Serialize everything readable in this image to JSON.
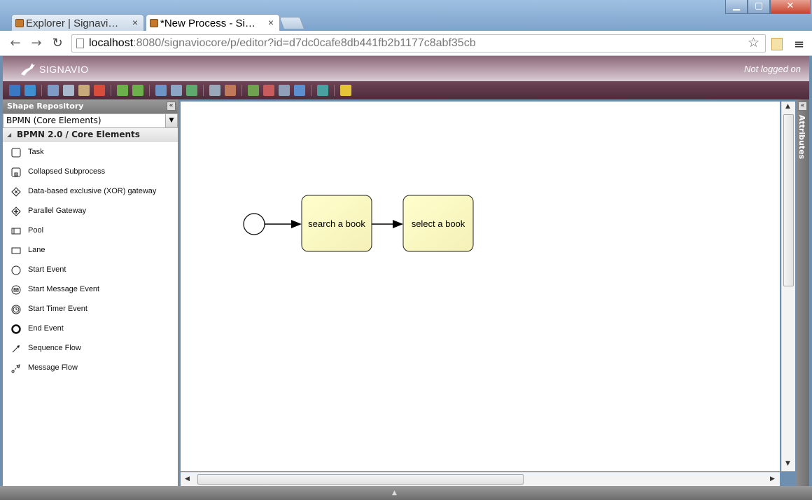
{
  "browser": {
    "tabs": [
      {
        "title": "Explorer | Signavio ...",
        "active": false
      },
      {
        "title": "*New Process - Signa",
        "active": true
      }
    ],
    "url": {
      "host": "localhost",
      "rest": ":8080/signaviocore/p/editor?id=d7dc0cafe8db441fb2b1177c8abf35cb"
    }
  },
  "header": {
    "brand": "SIGNAVIO",
    "login_status": "Not logged on"
  },
  "colors": {
    "header": "#8a6878",
    "toolbar": "#5a3647",
    "task_fill": "#ffffcc"
  },
  "shape_panel": {
    "title": "Shape Repository",
    "stencil_set": "BPMN (Core Elements)",
    "group": "BPMN 2.0 / Core Elements",
    "items": [
      {
        "label": "Task",
        "icon": "task-icon"
      },
      {
        "label": "Collapsed Subprocess",
        "icon": "subprocess-icon"
      },
      {
        "label": "Data-based exclusive (XOR) gateway",
        "icon": "xor-gateway-icon"
      },
      {
        "label": "Parallel Gateway",
        "icon": "parallel-gateway-icon"
      },
      {
        "label": "Pool",
        "icon": "pool-icon"
      },
      {
        "label": "Lane",
        "icon": "lane-icon"
      },
      {
        "label": "Start Event",
        "icon": "start-event-icon"
      },
      {
        "label": "Start Message Event",
        "icon": "message-event-icon"
      },
      {
        "label": "Start Timer Event",
        "icon": "timer-event-icon"
      },
      {
        "label": "End Event",
        "icon": "end-event-icon"
      },
      {
        "label": "Sequence Flow",
        "icon": "sequence-flow-icon"
      },
      {
        "label": "Message Flow",
        "icon": "message-flow-icon"
      }
    ]
  },
  "diagram": {
    "tasks": [
      "search a book",
      "select a book"
    ]
  },
  "attributes_panel": {
    "label": "Attributes"
  }
}
